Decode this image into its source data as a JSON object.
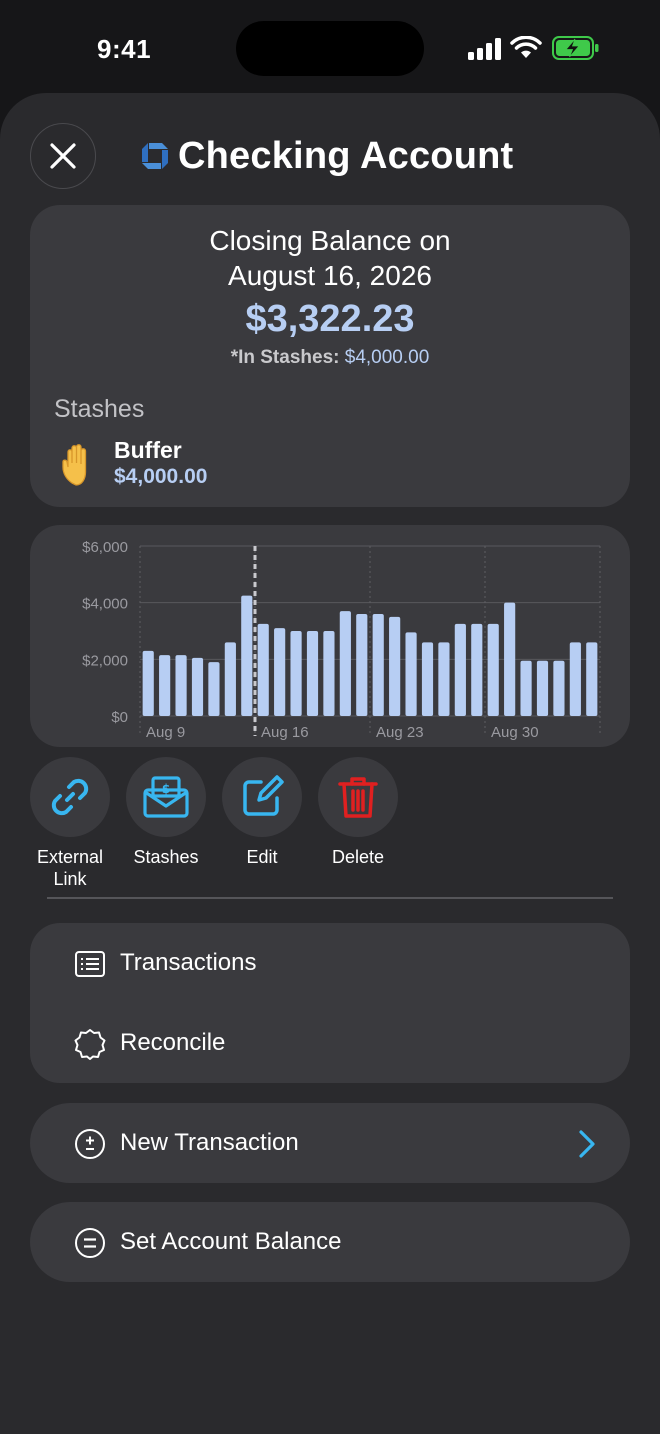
{
  "status_bar": {
    "time": "9:41"
  },
  "header": {
    "title": "Checking Account"
  },
  "balance": {
    "closing_line1": "Closing Balance on",
    "closing_line2": "August 16, 2026",
    "amount": "$3,322.23",
    "in_stashes_label": "*In Stashes:",
    "in_stashes_value": "$4,000.00",
    "stashes_heading": "Stashes",
    "stash_items": [
      {
        "name": "Buffer",
        "amount": "$4,000.00",
        "icon": "raised-hand-icon"
      }
    ]
  },
  "chart_data": {
    "type": "bar",
    "y_ticks": [
      "$6,000",
      "$4,000",
      "$2,000",
      "$0"
    ],
    "ylim": [
      0,
      6000
    ],
    "x_tick_labels": [
      "Aug 9",
      "Aug 16",
      "Aug 23",
      "Aug 30"
    ],
    "values": [
      2300,
      2150,
      2150,
      2050,
      1900,
      2600,
      4250,
      3250,
      3100,
      3000,
      3000,
      3000,
      3700,
      3600,
      3600,
      3500,
      2950,
      2600,
      2600,
      3250,
      3250,
      3250,
      4000,
      1950,
      1950,
      1950,
      2600,
      2600
    ],
    "selected_index": 7,
    "bar_color": "#b7cef3",
    "grid": true
  },
  "actions": [
    {
      "label": "External Link",
      "icon": "link-icon"
    },
    {
      "label": "Stashes",
      "icon": "envelope-icon"
    },
    {
      "label": "Edit",
      "icon": "edit-icon"
    },
    {
      "label": "Delete",
      "icon": "trash-icon"
    }
  ],
  "menu": {
    "transactions": "Transactions",
    "reconcile": "Reconcile",
    "new_transaction": "New Transaction",
    "set_balance": "Set Account Balance"
  },
  "colors": {
    "accent": "#38b6f0",
    "delete": "#e02020",
    "balance": "#b7cef3"
  }
}
